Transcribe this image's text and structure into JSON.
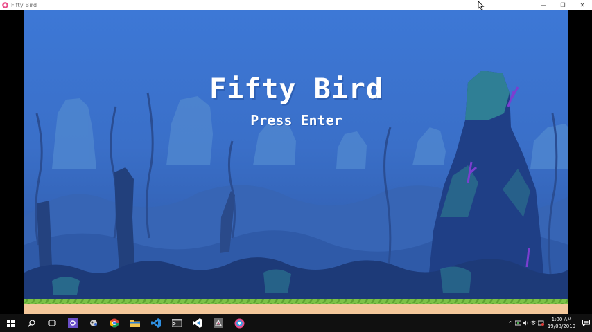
{
  "window": {
    "title": "Fifty Bird",
    "minimize_glyph": "—",
    "restore_glyph": "❐",
    "close_glyph": "✕"
  },
  "game": {
    "title": "Fifty Bird",
    "subtitle": "Press Enter",
    "colors": {
      "water": "#3a74d2",
      "text": "#ffffff",
      "grass": "#79c244",
      "sand": "#f3c79a"
    }
  },
  "taskbar": {
    "apps": [
      {
        "name": "start-button",
        "icon": "windows-logo-icon"
      },
      {
        "name": "search-button",
        "icon": "search-icon"
      },
      {
        "name": "task-view-button",
        "icon": "task-view-icon"
      },
      {
        "name": "app-settings-button",
        "icon": "purple-gear-icon"
      },
      {
        "name": "app-game-button",
        "icon": "game-icon"
      },
      {
        "name": "chrome-button",
        "icon": "chrome-icon"
      },
      {
        "name": "file-explorer-button",
        "icon": "folder-icon"
      },
      {
        "name": "vscode-button",
        "icon": "vscode-icon"
      },
      {
        "name": "terminal-button",
        "icon": "terminal-icon"
      },
      {
        "name": "visual-studio-button",
        "icon": "visual-studio-icon"
      },
      {
        "name": "love2d-button",
        "icon": "love-icon"
      },
      {
        "name": "fifty-bird-button",
        "icon": "heart-app-icon"
      }
    ],
    "tray": {
      "time": "1:00 AM",
      "date": "19/08/2019"
    }
  }
}
